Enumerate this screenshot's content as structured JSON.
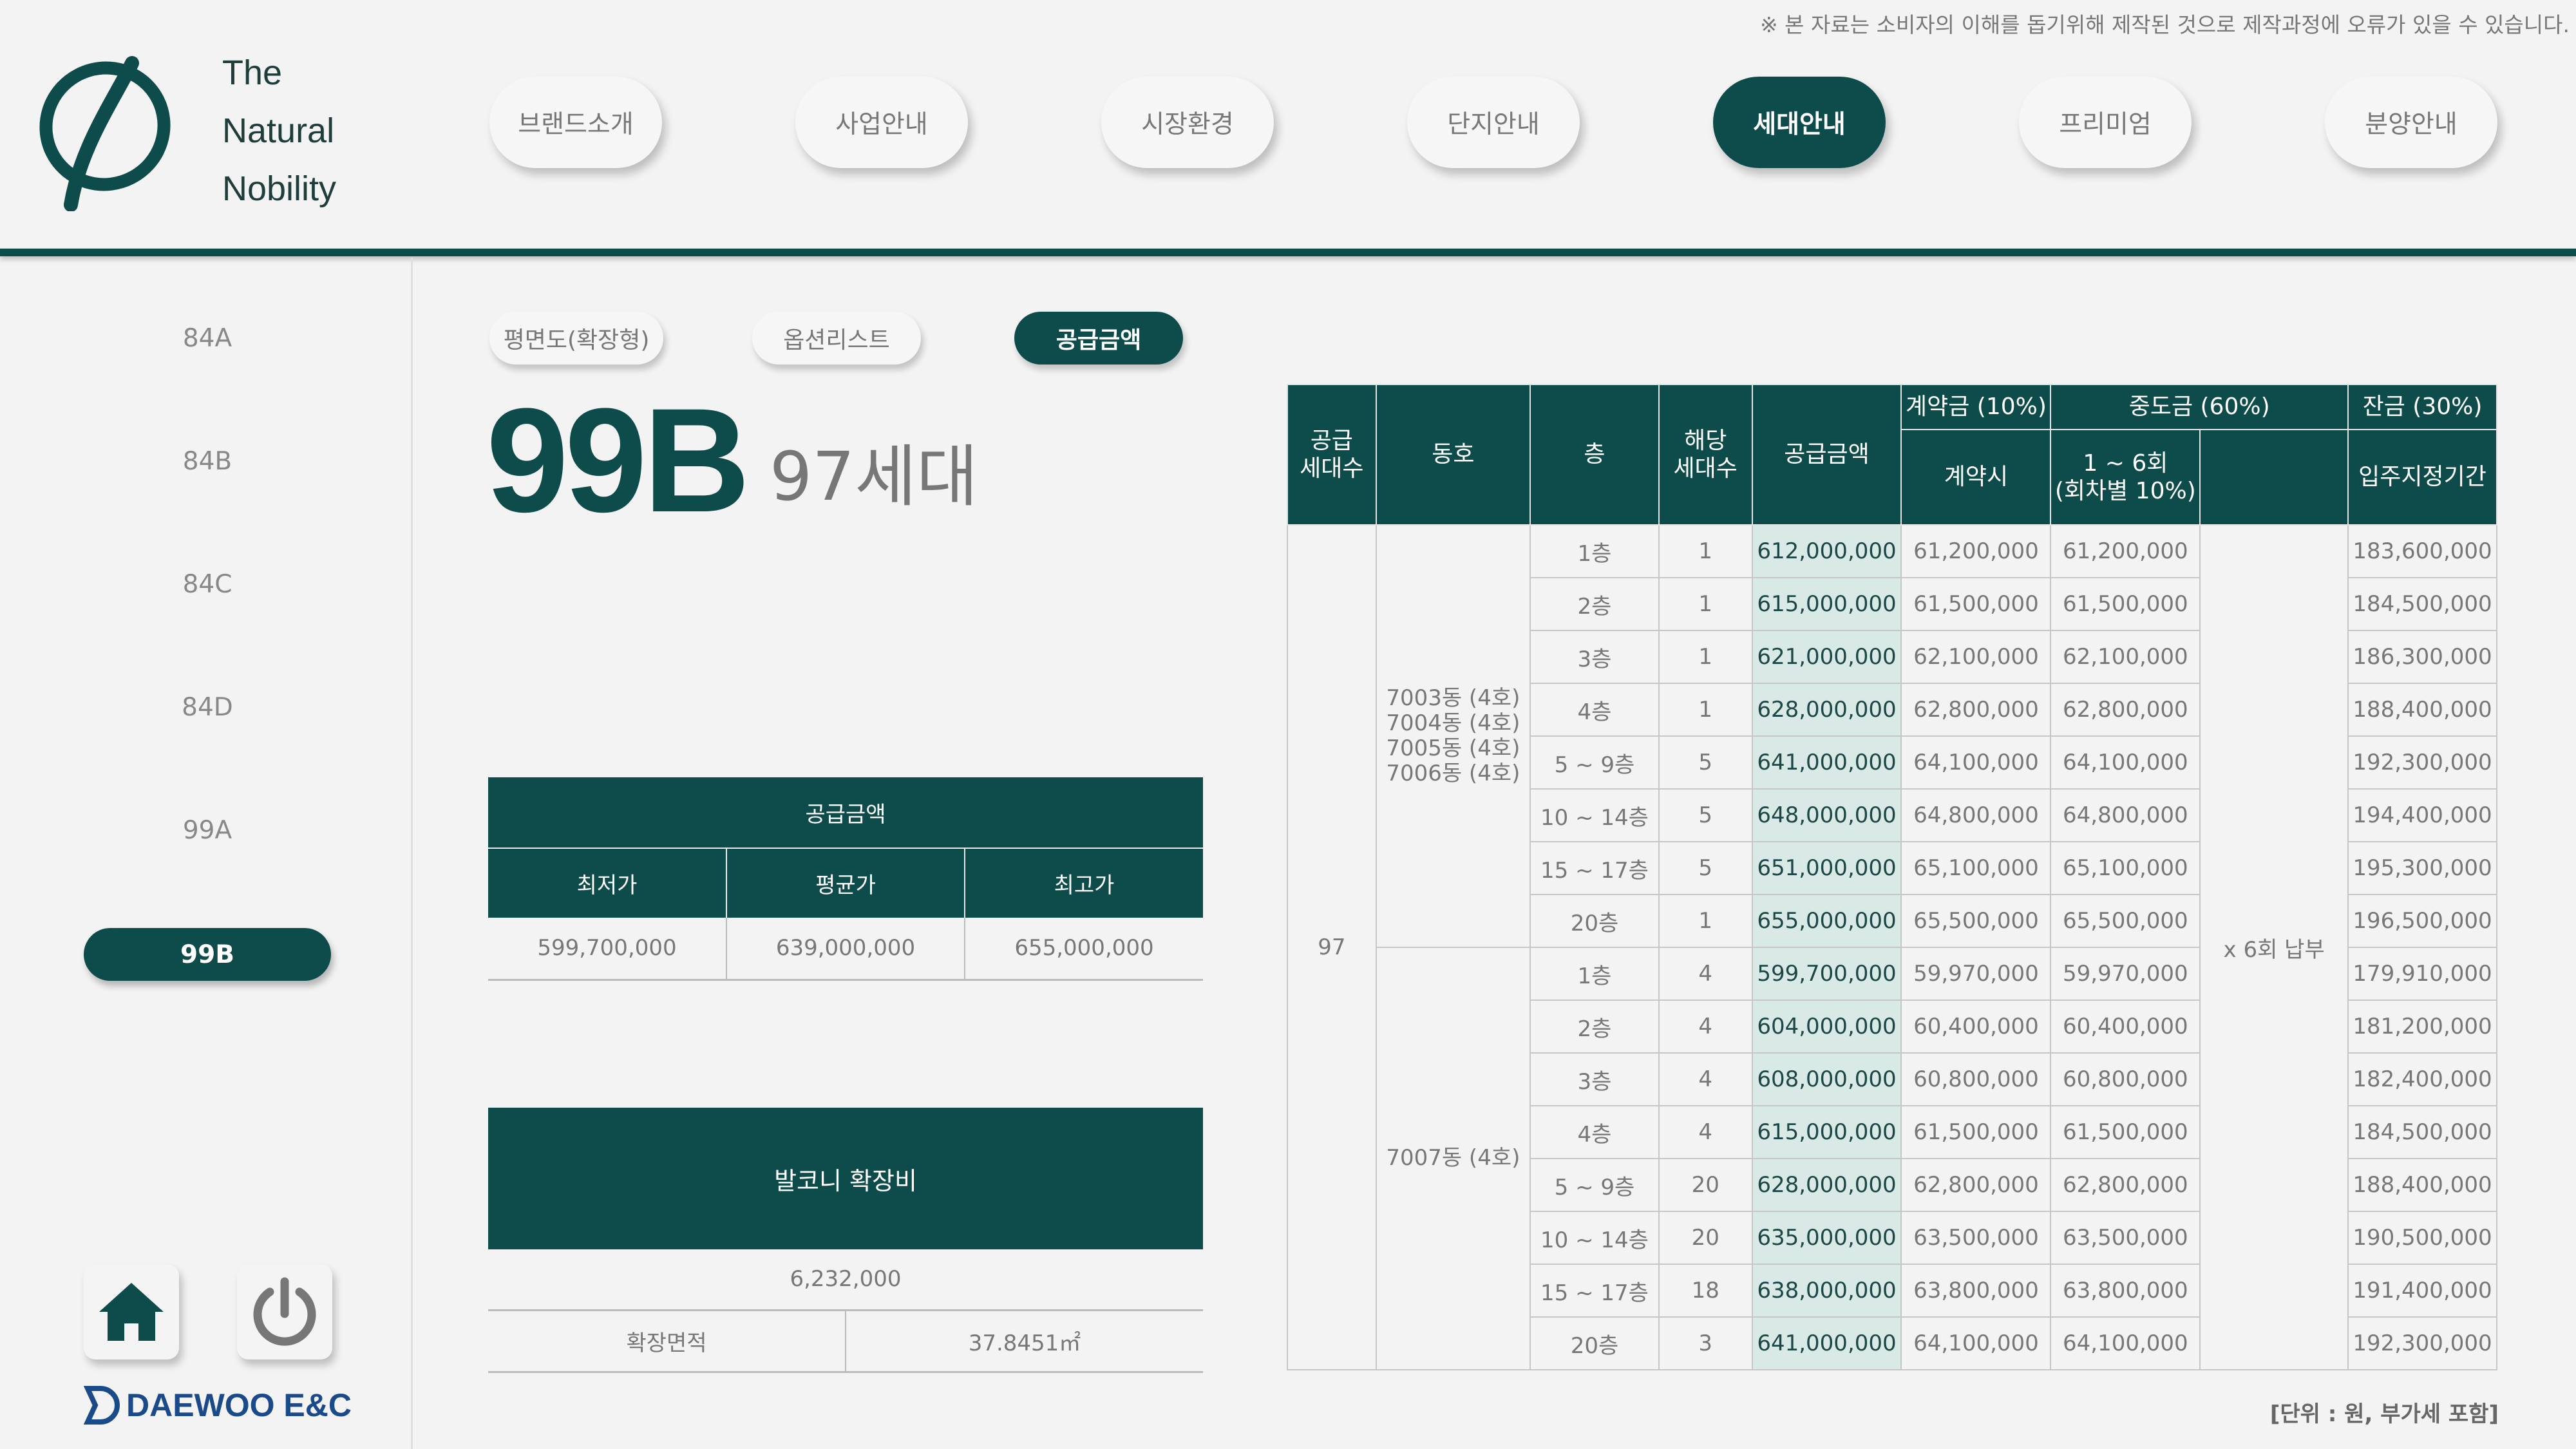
{
  "disclaimer": "※ 본 자료는 소비자의 이해를 돕기위해 제작된 것으로 제작과정에 오류가 있을 수 있습니다.",
  "logo": {
    "line1": "The",
    "line2": "Natural",
    "line3": "Nobility",
    "accent": "#0d4c4b"
  },
  "nav": [
    "브랜드소개",
    "사업안내",
    "시장환경",
    "단지안내",
    "세대안내",
    "프리미엄",
    "분양안내"
  ],
  "nav_active": "세대안내",
  "sidebar": [
    "84A",
    "84B",
    "84C",
    "84D",
    "99A",
    "99B"
  ],
  "sidebar_active": "99B",
  "subtabs": [
    "평면도(확장형)",
    "옵션리스트",
    "공급금액"
  ],
  "subtab_active": "공급금액",
  "unit": {
    "type": "99B",
    "households": "97세대"
  },
  "summary": {
    "title": "공급금액",
    "headers": [
      "최저가",
      "평균가",
      "최고가"
    ],
    "values": [
      "599,700,000",
      "639,000,000",
      "655,000,000"
    ]
  },
  "balcony": {
    "title": "발코니 확장비",
    "cost": "6,232,000",
    "area_label": "확장면적",
    "area_value": "37.8451㎡"
  },
  "price_table": {
    "headers": {
      "supply_households": "공급\n세대수",
      "dong": "동호",
      "floor": "층",
      "count": "해당\n세대수",
      "price": "공급금액",
      "deposit": "계약금 (10%)",
      "deposit_sub": "계약시",
      "middle": "중도금 (60%)",
      "middle_sub": "1 ~ 6회\n(회차별 10%)",
      "balance": "잔금 (30%)",
      "balance_sub": "입주지정기간"
    },
    "supply_households": "97",
    "middle_note": "x 6회 납부",
    "groups": [
      {
        "dong": "7003동 (4호)\n7004동 (4호)\n7005동 (4호)\n7006동 (4호)",
        "rows": [
          [
            "1층",
            "1",
            "612,000,000",
            "61,200,000",
            "61,200,000",
            "183,600,000"
          ],
          [
            "2층",
            "1",
            "615,000,000",
            "61,500,000",
            "61,500,000",
            "184,500,000"
          ],
          [
            "3층",
            "1",
            "621,000,000",
            "62,100,000",
            "62,100,000",
            "186,300,000"
          ],
          [
            "4층",
            "1",
            "628,000,000",
            "62,800,000",
            "62,800,000",
            "188,400,000"
          ],
          [
            "5 ~ 9층",
            "5",
            "641,000,000",
            "64,100,000",
            "64,100,000",
            "192,300,000"
          ],
          [
            "10 ~ 14층",
            "5",
            "648,000,000",
            "64,800,000",
            "64,800,000",
            "194,400,000"
          ],
          [
            "15 ~ 17층",
            "5",
            "651,000,000",
            "65,100,000",
            "65,100,000",
            "195,300,000"
          ],
          [
            "20층",
            "1",
            "655,000,000",
            "65,500,000",
            "65,500,000",
            "196,500,000"
          ]
        ]
      },
      {
        "dong": "7007동 (4호)",
        "rows": [
          [
            "1층",
            "4",
            "599,700,000",
            "59,970,000",
            "59,970,000",
            "179,910,000"
          ],
          [
            "2층",
            "4",
            "604,000,000",
            "60,400,000",
            "60,400,000",
            "181,200,000"
          ],
          [
            "3층",
            "4",
            "608,000,000",
            "60,800,000",
            "60,800,000",
            "182,400,000"
          ],
          [
            "4층",
            "4",
            "615,000,000",
            "61,500,000",
            "61,500,000",
            "184,500,000"
          ],
          [
            "5 ~ 9층",
            "20",
            "628,000,000",
            "62,800,000",
            "62,800,000",
            "188,400,000"
          ],
          [
            "10 ~ 14층",
            "20",
            "635,000,000",
            "63,500,000",
            "63,500,000",
            "190,500,000"
          ],
          [
            "15 ~ 17층",
            "18",
            "638,000,000",
            "63,800,000",
            "63,800,000",
            "191,400,000"
          ],
          [
            "20층",
            "3",
            "641,000,000",
            "64,100,000",
            "64,100,000",
            "192,300,000"
          ]
        ]
      }
    ],
    "unit_note": "[단위 : 원, 부가세 포함]"
  },
  "brand_footer": "DAEWOO E&C"
}
